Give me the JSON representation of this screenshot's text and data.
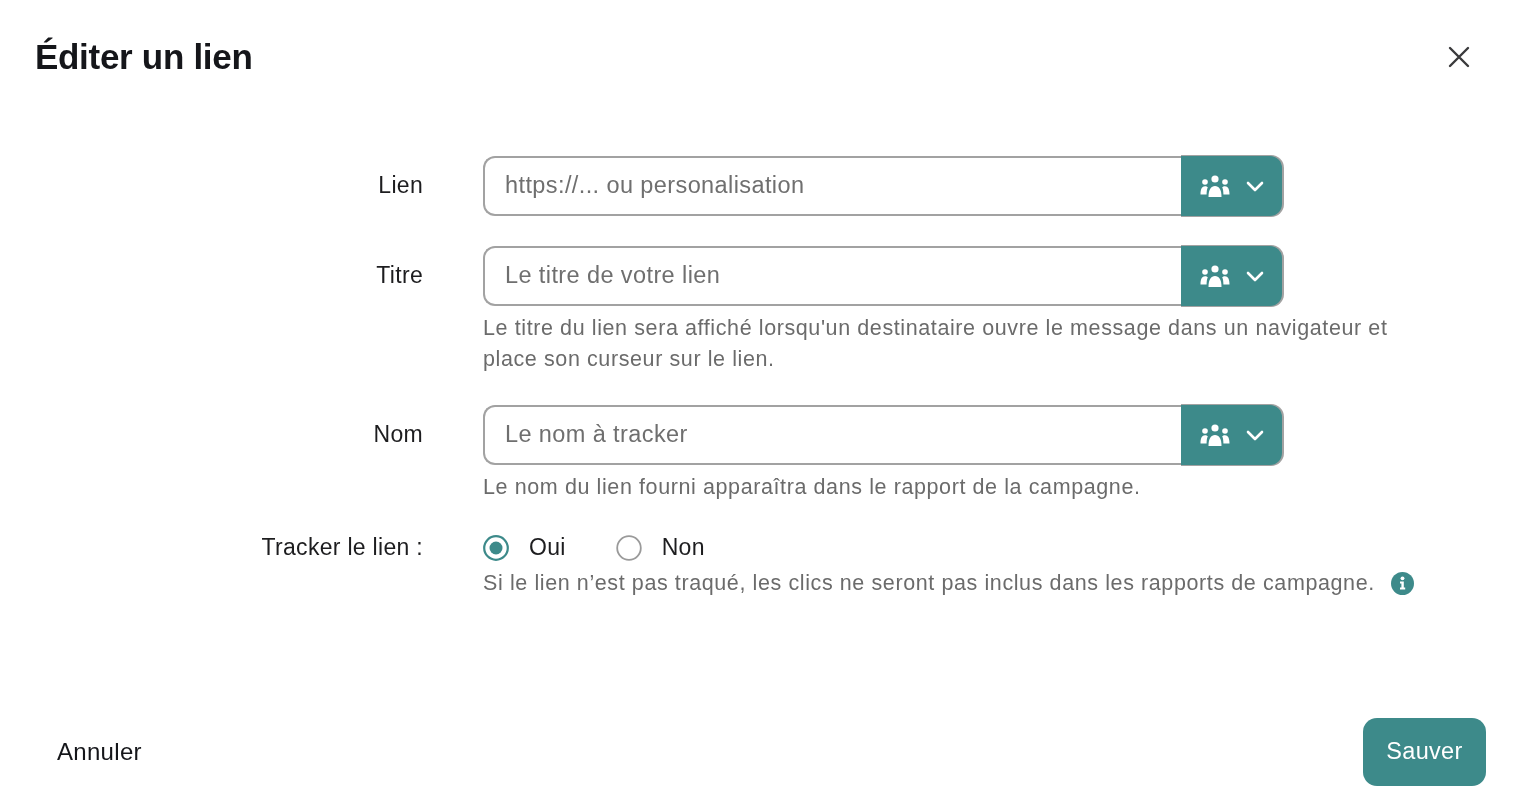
{
  "dialog": {
    "title": "Éditer un lien"
  },
  "fields": [
    {
      "label": "Lien",
      "placeholder": "https://... ou personalisation"
    },
    {
      "label": "Titre",
      "placeholder": "Le titre de votre lien",
      "help": "Le titre du lien sera affiché lorsqu'un destinataire ouvre le message dans un navigateur et place son curseur sur le lien."
    },
    {
      "label": "Nom",
      "placeholder": "Le nom à tracker",
      "help": "Le nom du lien fourni apparaîtra dans le rapport de la campagne."
    }
  ],
  "tracking": {
    "label": "Tracker le lien :",
    "options": [
      {
        "label": "Oui",
        "selected": true
      },
      {
        "label": "Non",
        "selected": false
      }
    ],
    "help": "Si le lien n’est pas traqué, les clics ne seront pas inclus dans les rapports de campagne."
  },
  "footer": {
    "cancel": "Annuler",
    "save": "Sauver"
  }
}
